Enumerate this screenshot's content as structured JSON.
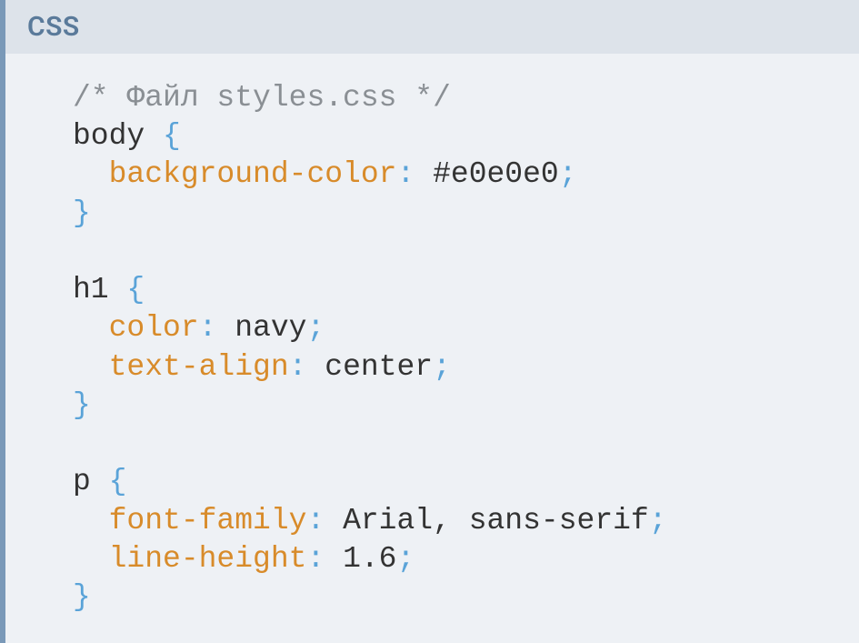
{
  "header_label": "CSS",
  "code": {
    "comment": "/* Файл styles.css */",
    "rules": [
      {
        "selector": "body",
        "declarations": [
          {
            "property": "background-color",
            "value": "#e0e0e0"
          }
        ]
      },
      {
        "selector": "h1",
        "declarations": [
          {
            "property": "color",
            "value": "navy"
          },
          {
            "property": "text-align",
            "value": "center"
          }
        ]
      },
      {
        "selector": "p",
        "declarations": [
          {
            "property": "font-family",
            "value": "Arial, sans-serif"
          },
          {
            "property": "line-height",
            "value": "1.6"
          }
        ]
      }
    ]
  }
}
